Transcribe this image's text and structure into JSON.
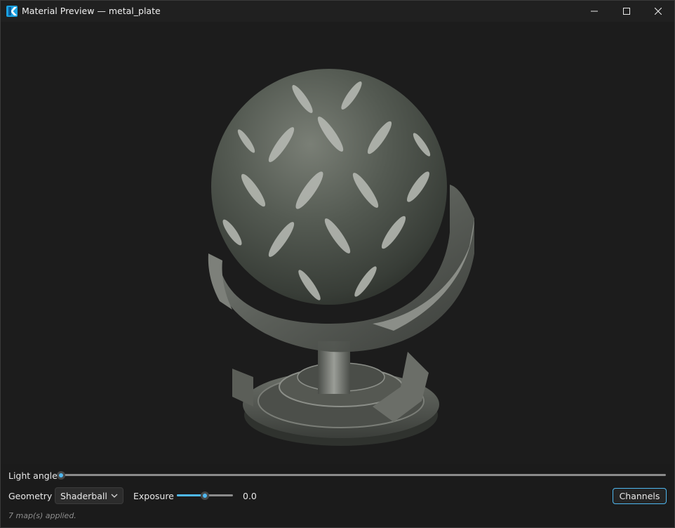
{
  "window": {
    "title": "Material Preview — metal_plate",
    "app_icon": "krita-k-icon",
    "controls": [
      "minimize-icon",
      "maximize-icon",
      "close-icon"
    ]
  },
  "viewport": {
    "preview_object": "shaderball",
    "background": "#1c1c1c"
  },
  "controls": {
    "light_angle": {
      "label": "Light angle",
      "value": 0.0
    },
    "geometry": {
      "label": "Geometry",
      "selected": "Shaderball"
    },
    "exposure": {
      "label": "Exposure",
      "value_text": "0.0",
      "level": 0.5
    },
    "channels_button": "Channels"
  },
  "status": "7 map(s) applied.",
  "colors": {
    "accent": "#4fb8f0",
    "titlebar": "#202020",
    "panel": "#1b1b1b"
  }
}
